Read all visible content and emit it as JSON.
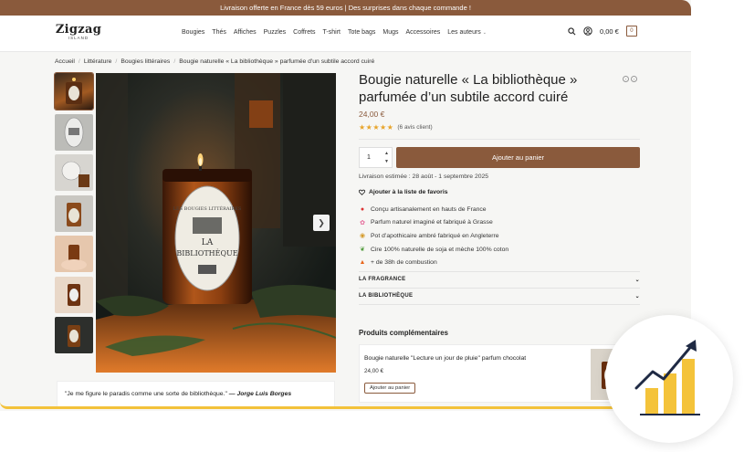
{
  "promo_bar": {
    "text": "Livraison offerte en France dès 59 euros | Des surprises dans chaque commande !"
  },
  "header": {
    "logo_main": "Zigzag",
    "logo_sub": "ISLAND",
    "nav": [
      "Bougies",
      "Thés",
      "Affiches",
      "Puzzles",
      "Coffrets",
      "T-shirt",
      "Tote bags",
      "Mugs",
      "Accessoires",
      "Les auteurs"
    ],
    "cart_total": "0,00 €",
    "cart_count": "0"
  },
  "breadcrumb": [
    "Accueil",
    "Littérature",
    "Bougies littéraires",
    "Bougie naturelle « La bibliothèque » parfumée d'un subtile accord cuiré"
  ],
  "product": {
    "title": "Bougie naturelle « La bibliothèque » parfumée d’un subtile accord cuiré",
    "price": "24,00 €",
    "rating": 5,
    "reviews": "(6 avis client)",
    "qty": "1",
    "add_to_cart": "Ajouter au panier",
    "delivery": "Livraison estimée : 28 août - 1 septembre 2025",
    "wishlist": "Ajouter à la liste de favoris",
    "features": [
      {
        "icon": "pin-icon",
        "text": "Conçu artisanalement en hauts de France"
      },
      {
        "icon": "flower-icon",
        "text": "Parfum naturel imaginé et fabriqué à Grasse"
      },
      {
        "icon": "jar-icon",
        "text": "Pot d’apothicaire ambré fabriqué en Angleterre"
      },
      {
        "icon": "leaf-icon",
        "text": "Cire 100% naturelle de soja et mèche 100% coton"
      },
      {
        "icon": "flame-icon",
        "text": "+ de 38h de combustion"
      }
    ],
    "accordions": [
      "LA FRAGRANCE",
      "LA BIBLIOTHÈQUE"
    ],
    "image_label": {
      "line1": "LES BOUGIES LITTÉRAIRES",
      "line2": "LA",
      "line3": "BIBLIOTHÈQUE"
    }
  },
  "quote": {
    "text": "\"Je me figure le paradis comme une sorte de bibliothèque.\"",
    "author": "— Jorge Luis Borges"
  },
  "related": {
    "title": "Produits complémentaires",
    "item_name": "Bougie naturelle \"Lecture un jour de pluie\" parfum chocolat",
    "item_price": "24,00 €",
    "item_button": "Ajouter au panier"
  },
  "colors": {
    "brand": "#8a5a3c",
    "accent": "#f3c23a",
    "stars": "#e7a42a"
  },
  "badge_chart": {
    "type": "bar",
    "values": [
      1,
      2,
      3
    ],
    "trend": "up"
  }
}
